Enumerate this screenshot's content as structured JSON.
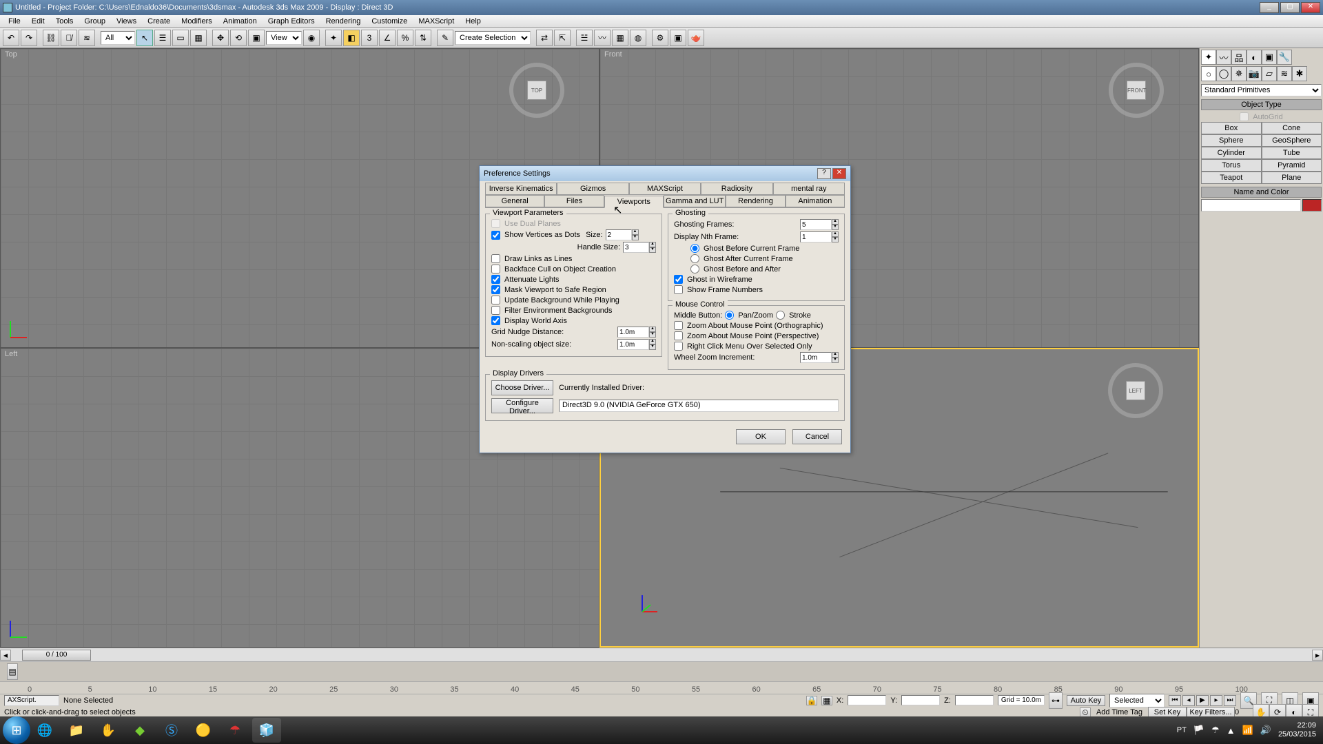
{
  "titlebar": {
    "text": "Untitled  -  Project Folder: C:\\Users\\Ednaldo36\\Documents\\3dsmax    -  Autodesk 3ds Max  2009   -   Display :  Direct 3D"
  },
  "menu": [
    "File",
    "Edit",
    "Tools",
    "Group",
    "Views",
    "Create",
    "Modifiers",
    "Animation",
    "Graph Editors",
    "Rendering",
    "Customize",
    "MAXScript",
    "Help"
  ],
  "toolbar": {
    "filter_all": "All",
    "view": "View",
    "selset": "Create Selection Set"
  },
  "viewports": {
    "top": "Top",
    "front": "Front",
    "left": "Left",
    "cube_top": "TOP",
    "cube_front": "FRONT",
    "cube_left": "LEFT"
  },
  "cmd": {
    "category": "Standard Primitives",
    "object_type": "Object Type",
    "autogrid": "AutoGrid",
    "btns": [
      "Box",
      "Cone",
      "Sphere",
      "GeoSphere",
      "Cylinder",
      "Tube",
      "Torus",
      "Pyramid",
      "Teapot",
      "Plane"
    ],
    "name_color": "Name and Color"
  },
  "time": {
    "slider": "0 / 100",
    "ruler": [
      "0",
      "5",
      "10",
      "15",
      "20",
      "25",
      "30",
      "35",
      "40",
      "45",
      "50",
      "55",
      "60",
      "65",
      "70",
      "75",
      "80",
      "85",
      "90",
      "95",
      "100"
    ]
  },
  "status": {
    "selection": "None Selected",
    "script": "AXScript.",
    "prompt": "Click or click-and-drag to select objects",
    "x": "X:",
    "y": "Y:",
    "z": "Z:",
    "grid": "Grid = 10.0m",
    "autokey": "Auto Key",
    "selected": "Selected",
    "setkey": "Set Key",
    "keyfilters": "Key Filters...",
    "addtimetag": "Add Time Tag"
  },
  "dialog": {
    "title": "Preference Settings",
    "tabs_row1": [
      "Inverse Kinematics",
      "Gizmos",
      "MAXScript",
      "Radiosity",
      "mental ray"
    ],
    "tabs_row2": [
      "General",
      "Files",
      "Viewports",
      "Gamma and LUT",
      "Rendering",
      "Animation"
    ],
    "vp_params": {
      "title": "Viewport Parameters",
      "dual": "Use Dual Planes",
      "vertdots": "Show Vertices as Dots",
      "size_lbl": "Size:",
      "size_val": "2",
      "handle_lbl": "Handle Size:",
      "handle_val": "3",
      "drawlinks": "Draw Links as Lines",
      "backface": "Backface Cull on Object Creation",
      "attenuate": "Attenuate Lights",
      "mask": "Mask Viewport to Safe Region",
      "updatebg": "Update Background While Playing",
      "filterenv": "Filter Environment Backgrounds",
      "worldaxis": "Display World Axis",
      "gridnudge": "Grid Nudge Distance:",
      "gridnudge_val": "1.0m",
      "nonscale": "Non-scaling object size:",
      "nonscale_val": "1.0m"
    },
    "ghost": {
      "title": "Ghosting",
      "frames": "Ghosting Frames:",
      "frames_val": "5",
      "nth": "Display Nth Frame:",
      "nth_val": "1",
      "before": "Ghost Before Current Frame",
      "after": "Ghost After Current Frame",
      "both": "Ghost Before and After",
      "wire": "Ghost in Wireframe",
      "shownum": "Show Frame Numbers"
    },
    "mouse": {
      "title": "Mouse Control",
      "middle": "Middle Button:",
      "panzoom": "Pan/Zoom",
      "stroke": "Stroke",
      "ortho": "Zoom About Mouse Point (Orthographic)",
      "persp": "Zoom About Mouse Point (Perspective)",
      "rclick": "Right Click Menu Over Selected Only",
      "wheel": "Wheel Zoom Increment:",
      "wheel_val": "1.0m"
    },
    "drivers": {
      "title": "Display Drivers",
      "choose": "Choose Driver...",
      "configure": "Configure Driver...",
      "currently": "Currently Installed Driver:",
      "driver": "Direct3D 9.0 (NVIDIA GeForce GTX 650)"
    },
    "ok": "OK",
    "cancel": "Cancel"
  },
  "taskbar": {
    "lang": "PT",
    "time": "22:09",
    "date": "25/03/2015"
  }
}
